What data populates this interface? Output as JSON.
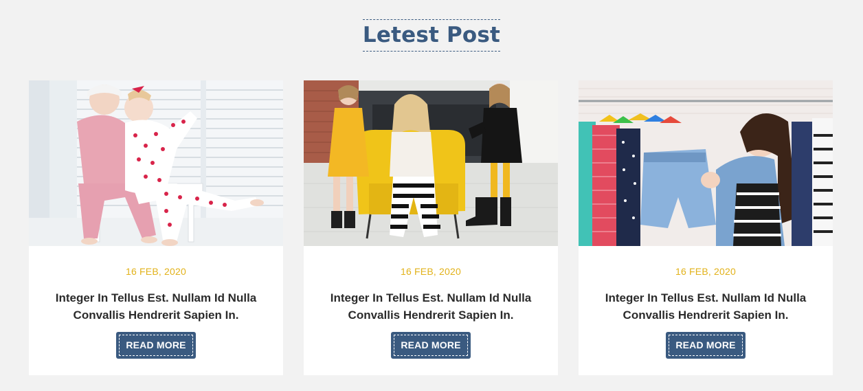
{
  "section": {
    "title": "Letest Post"
  },
  "colors": {
    "background": "#f2f2f2",
    "title": "#3a5a80",
    "date": "#e2b21a",
    "button": "#3a5a80",
    "button_text": "#ffffff",
    "card": "#ffffff"
  },
  "posts": [
    {
      "image": "two girls in pajamas on a white bench",
      "date": "16 FEB, 2020",
      "title": "Integer In Tellus Est. Nullam Id Nulla Convallis Hendrerit Sapien In.",
      "button_label": "READ MORE"
    },
    {
      "image": "three girls posing around a yellow armchair",
      "date": "16 FEB, 2020",
      "title": "Integer In Tellus Est. Nullam Id Nulla Convallis Hendrerit Sapien In.",
      "button_label": "READ MORE"
    },
    {
      "image": "girl holding denim shorts in front of a clothes rack",
      "date": "16 FEB, 2020",
      "title": "Integer In Tellus Est. Nullam Id Nulla Convallis Hendrerit Sapien In.",
      "button_label": "READ MORE"
    }
  ]
}
